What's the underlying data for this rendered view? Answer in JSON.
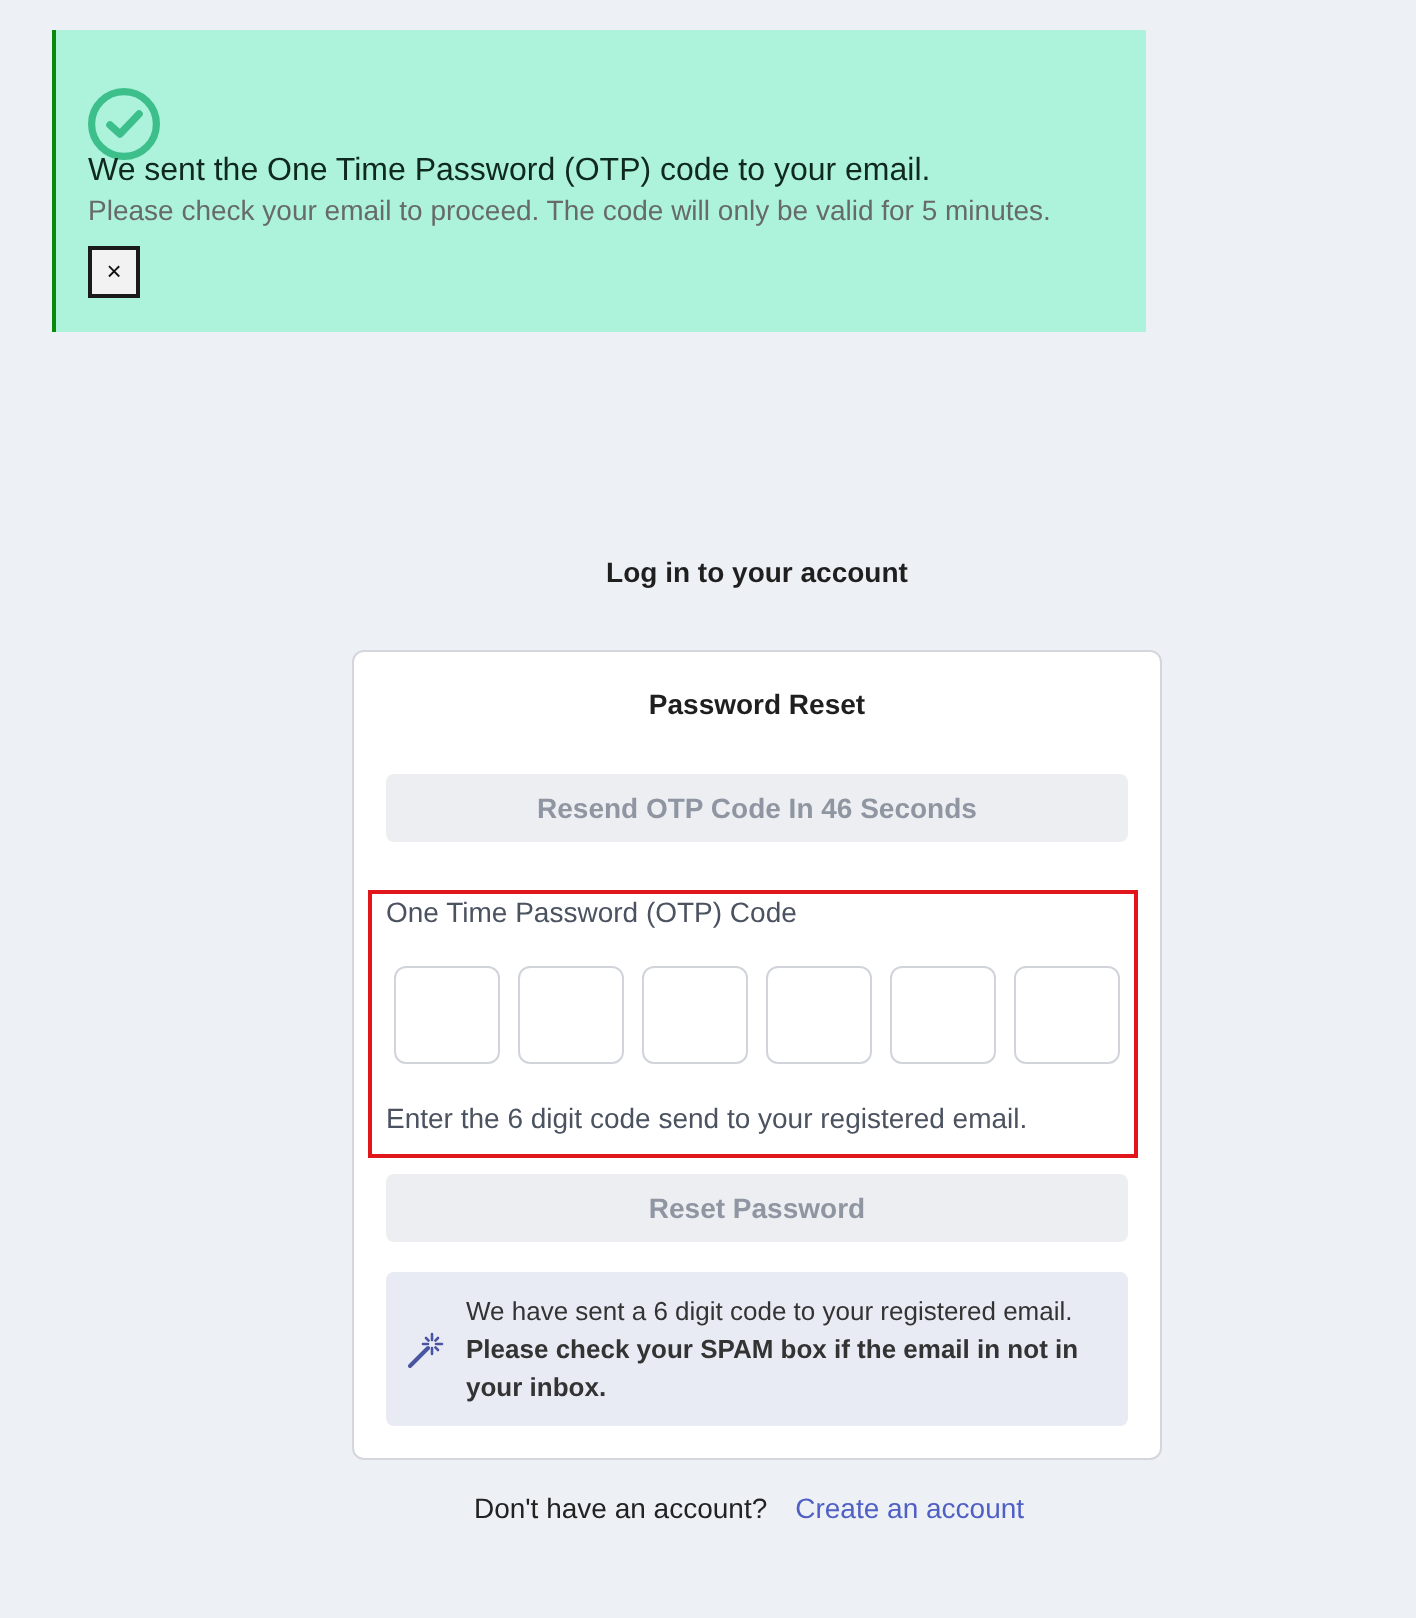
{
  "toast": {
    "kind": "success",
    "title": "We sent the One Time Password (OTP) code to your email.",
    "message": "Please check your email to proceed. The code will only be valid for 5 minutes.",
    "close_label": "×"
  },
  "heading": "Log in to your account",
  "card": {
    "title": "Password Reset",
    "resend_button": {
      "label": "Resend OTP Code In 46 Seconds",
      "disabled": true
    },
    "otp": {
      "label": "One Time Password (OTP) Code",
      "highlighted": true,
      "boxes": [
        {
          "filled": false
        },
        {
          "filled": false
        },
        {
          "filled": false
        },
        {
          "filled": false
        },
        {
          "filled": false
        },
        {
          "filled": false
        }
      ],
      "hint": "Enter the 6 digit code send to your registered email."
    },
    "submit_button": {
      "label": "Reset Password",
      "disabled": true
    },
    "notice": {
      "text": "We have sent a 6 digit code to your registered email. **Please check your SPAM box if the email in not in your inbox.**"
    }
  },
  "footer": {
    "prompt": "Don't have an account?",
    "link": "Create an account"
  }
}
